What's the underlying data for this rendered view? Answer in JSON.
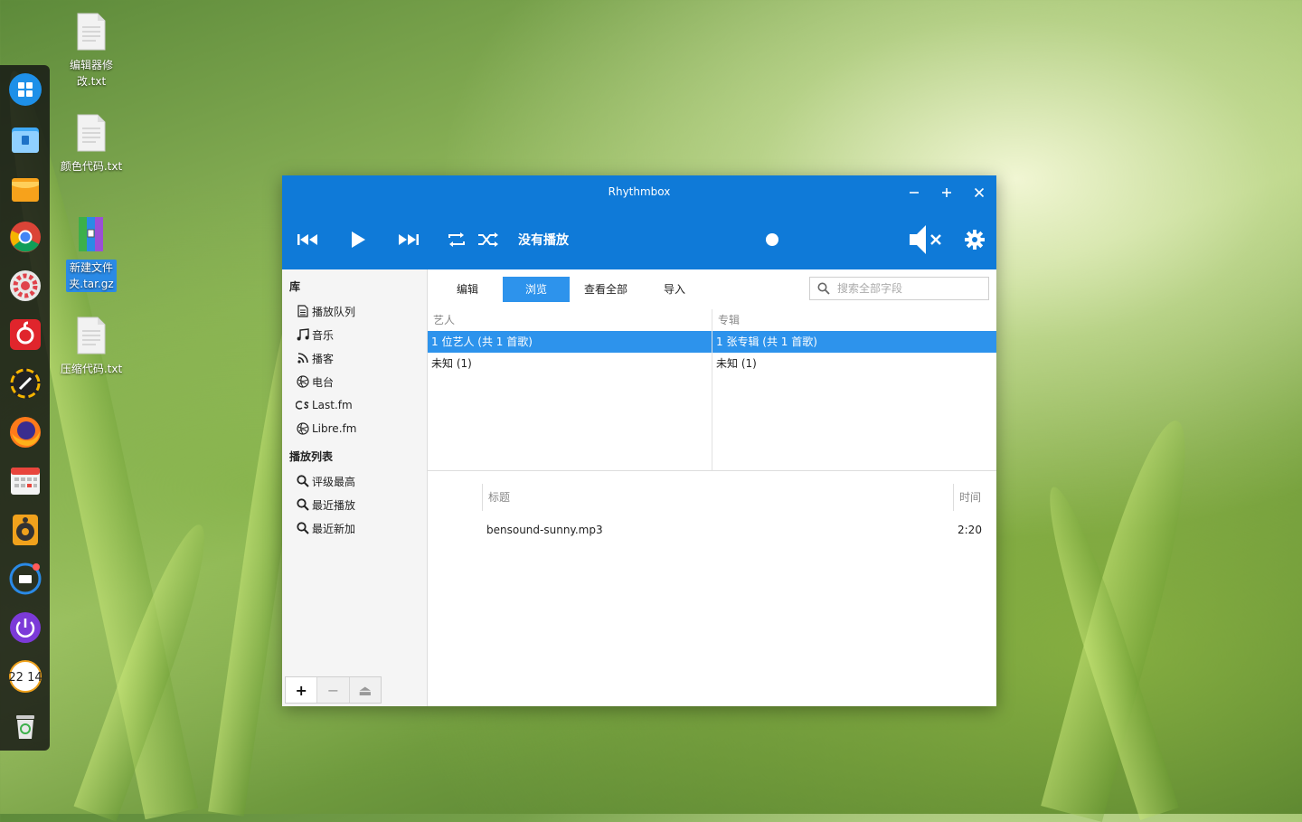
{
  "desktop": {
    "icons": [
      {
        "label_line1": "编辑器修",
        "label_line2": "改.txt"
      },
      {
        "label_line1": "颜色代码.txt",
        "label_line2": ""
      },
      {
        "label_line1": "新建文件",
        "label_line2": "夹.tar.gz"
      },
      {
        "label_line1": "压缩代码.txt",
        "label_line2": ""
      }
    ]
  },
  "dock": {
    "items": [
      "launcher-icon",
      "file-manager-icon",
      "app-store-icon",
      "chrome-icon",
      "settings-icon",
      "netease-music-icon",
      "screen-recorder-icon",
      "firefox-icon",
      "calendar-icon",
      "rhythmbox-icon",
      "keyboard-icon",
      "power-icon",
      "clock-icon",
      "trash-icon"
    ],
    "clock_text": "22 14"
  },
  "window": {
    "title": "Rhythmbox",
    "now_playing": "没有播放",
    "accent": "#0f7ad8",
    "selection": "#2d93ec"
  },
  "sidebar": {
    "library_header": "库",
    "library_items": [
      "播放队列",
      "音乐",
      "播客",
      "电台",
      "Last.fm",
      "Libre.fm"
    ],
    "playlists_header": "播放列表",
    "playlist_items": [
      "评级最高",
      "最近播放",
      "最近新加"
    ],
    "buttons": {
      "add": "+",
      "remove": "−",
      "eject": "⏏"
    }
  },
  "main": {
    "tabs": [
      "编辑",
      "浏览",
      "查看全部",
      "导入"
    ],
    "active_tab": "浏览",
    "search_placeholder": "搜索全部字段",
    "artist_column": {
      "header": "艺人",
      "rows": [
        "1 位艺人 (共 1 首歌)",
        "未知 (1)"
      ]
    },
    "album_column": {
      "header": "专辑",
      "rows": [
        "1 张专辑 (共 1 首歌)",
        "未知 (1)"
      ]
    },
    "track_headers": {
      "title": "标题",
      "time": "时间"
    },
    "tracks": [
      {
        "title": "bensound-sunny.mp3",
        "time": "2:20"
      }
    ]
  }
}
